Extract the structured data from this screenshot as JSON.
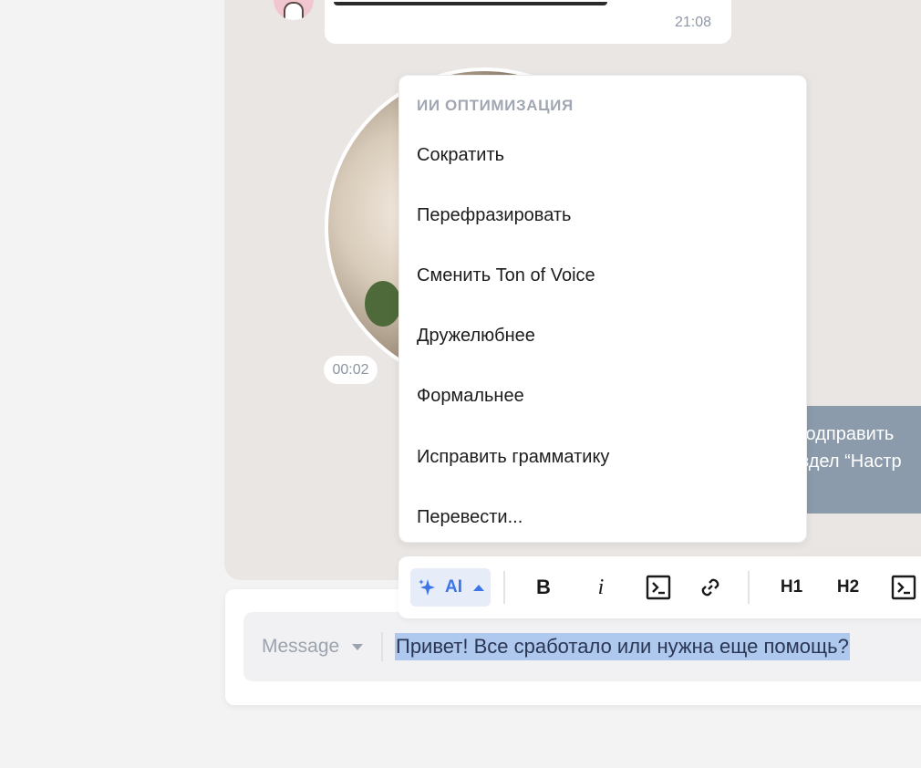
{
  "chat": {
    "incoming_time": "21:08",
    "video_duration": "00:02",
    "outgoing_lines": [
      "о подправить",
      "раздел “Настр"
    ]
  },
  "ai_menu": {
    "heading": "ИИ ОПТИМИЗАЦИЯ",
    "items": [
      "Сократить",
      "Перефразировать",
      "Сменить Ton of Voice",
      "Дружелюбнее",
      "Формальнее",
      "Исправить грамматику",
      "Перевести..."
    ]
  },
  "toolbar": {
    "ai_label": "AI",
    "bold_label": "B",
    "italic_label": "i",
    "h1_label": "H1",
    "h2_label": "H2",
    "accent_color": "#3d74e8"
  },
  "composer": {
    "type_label": "Message",
    "text": "Привет! Все сработало или нужна еще помощь?",
    "selection_color": "#aec8ee"
  }
}
